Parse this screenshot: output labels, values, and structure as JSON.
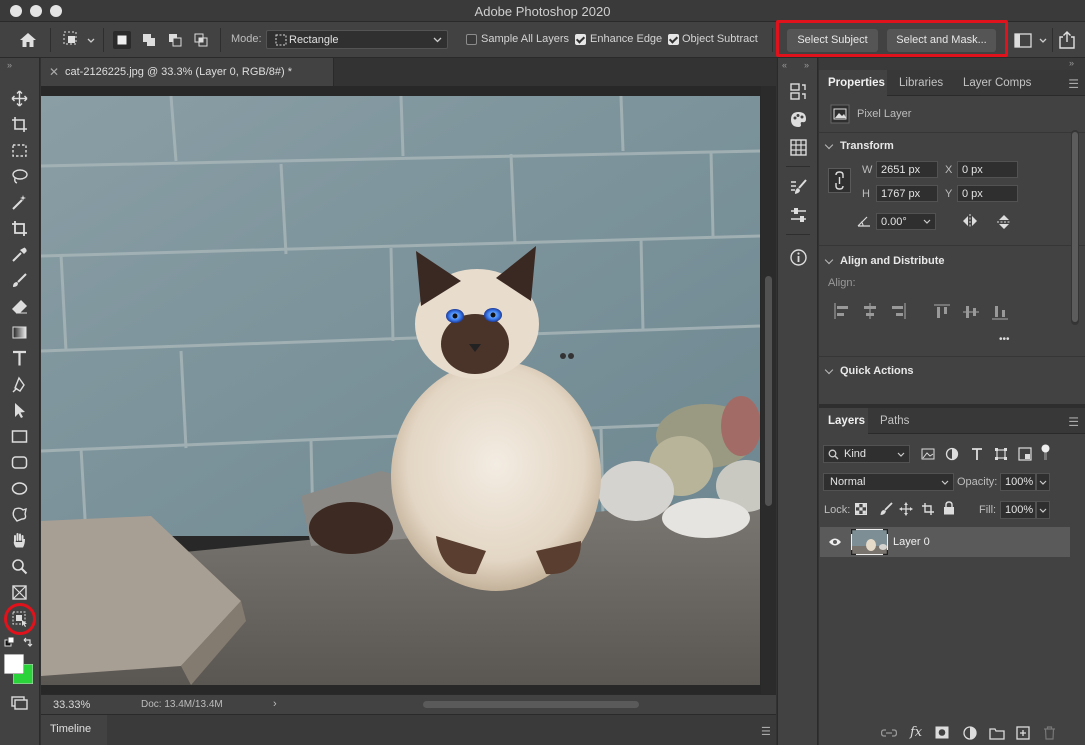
{
  "app": {
    "title": "Adobe Photoshop 2020"
  },
  "options": {
    "mode_label": "Mode:",
    "mode_value": "Rectangle",
    "sample_all_layers": "Sample All Layers",
    "enhance_edge": "Enhance Edge",
    "object_subtract": "Object Subtract",
    "select_subject": "Select Subject",
    "select_and_mask": "Select and Mask..."
  },
  "document": {
    "tab_title": "cat-2126225.jpg @ 33.3% (Layer 0, RGB/8#) *",
    "zoom": "33.33%",
    "doc_size": "Doc: 13.4M/13.4M"
  },
  "timeline": {
    "label": "Timeline"
  },
  "properties": {
    "tabs": [
      "Properties",
      "Libraries",
      "Layer Comps"
    ],
    "layer_type": "Pixel Layer",
    "transform_title": "Transform",
    "w_label": "W",
    "w_value": "2651 px",
    "h_label": "H",
    "h_value": "1767 px",
    "x_label": "X",
    "x_value": "0 px",
    "y_label": "Y",
    "y_value": "0 px",
    "angle_value": "0.00°",
    "align_title": "Align and Distribute",
    "align_label": "Align:",
    "more": "•••",
    "quick_actions_title": "Quick Actions"
  },
  "layers": {
    "tabs": [
      "Layers",
      "Paths"
    ],
    "kind_label": "Kind",
    "blend_mode": "Normal",
    "opacity_label": "Opacity:",
    "opacity_value": "100%",
    "lock_label": "Lock:",
    "fill_label": "Fill:",
    "fill_value": "100%",
    "items": [
      {
        "name": "Layer 0",
        "visible": true
      }
    ]
  },
  "colors": {
    "highlight": "#e0121b",
    "foreground": "#ffffff",
    "background": "#2bd33a"
  }
}
